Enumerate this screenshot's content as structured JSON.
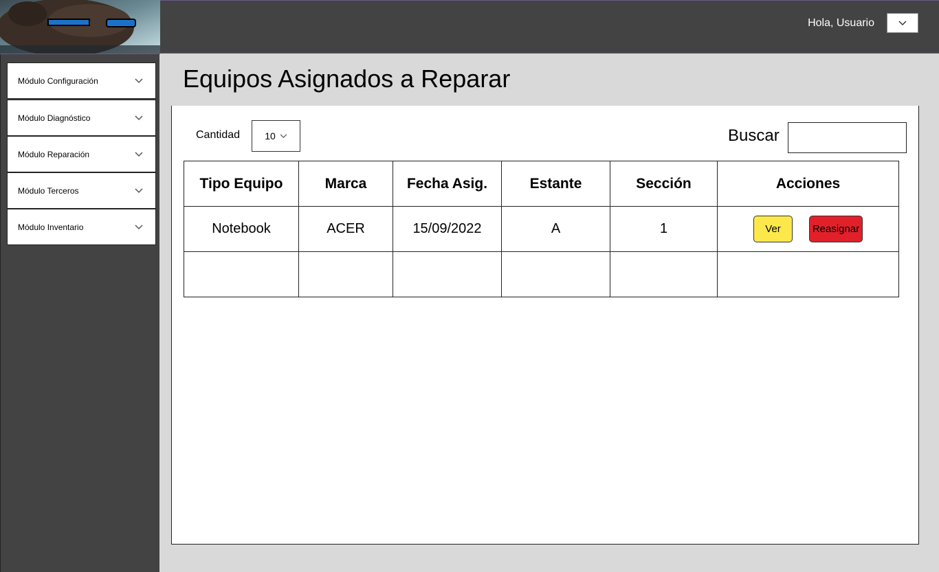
{
  "header": {
    "greeting": "Hola, Usuario",
    "user_menu_icon": "chevron-down-icon"
  },
  "sidebar": {
    "items": [
      {
        "label": "Módulo Configuración"
      },
      {
        "label": "Módulo Diagnóstico"
      },
      {
        "label": "Módulo Reparación"
      },
      {
        "label": "Módulo Terceros"
      },
      {
        "label": "Módulo Inventario"
      }
    ]
  },
  "main": {
    "title": "Equipos Asignados a Reparar",
    "cantidad_label": "Cantidad",
    "cantidad_value": "10",
    "buscar_label": "Buscar",
    "buscar_value": ""
  },
  "table": {
    "headers": [
      "Tipo Equipo",
      "Marca",
      "Fecha Asig.",
      "Estante",
      "Sección",
      "Acciones"
    ],
    "rows": [
      {
        "tipo": "Notebook",
        "marca": "ACER",
        "fecha": "15/09/2022",
        "estante": "A",
        "seccion": "1",
        "ver_label": "Ver",
        "reasignar_label": "Reasignar"
      },
      {
        "tipo": "",
        "marca": "",
        "fecha": "",
        "estante": "",
        "seccion": ""
      }
    ]
  },
  "colors": {
    "topbar": "#434343",
    "sidebar": "#434343",
    "ver_button": "#fde84b",
    "reasignar_button": "#e2202a"
  }
}
